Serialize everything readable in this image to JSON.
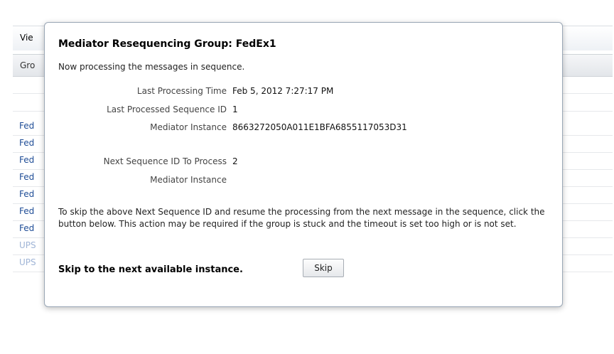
{
  "background": {
    "toolbar_label": "Vie",
    "column_header": "Gro",
    "rows": [
      "",
      "",
      "Fed",
      "Fed",
      "Fed",
      "Fed",
      "Fed",
      "Fed",
      "Fed",
      "UPS",
      "UPS"
    ]
  },
  "dialog": {
    "title": "Mediator Resequencing Group: FedEx1",
    "status": "Now processing the messages in sequence.",
    "fields": [
      {
        "label": "Last Processing Time",
        "value": "Feb 5, 2012 7:27:17 PM"
      },
      {
        "label": "Last Processed Sequence ID",
        "value": "1"
      },
      {
        "label": "Mediator Instance",
        "value": "8663272050A011E1BFA6855117053D31"
      },
      {
        "label": "Next Sequence ID To Process",
        "value": "2"
      },
      {
        "label": "Mediator Instance",
        "value": ""
      }
    ],
    "description": "To skip the above Next Sequence ID and resume the processing from the next message in the sequence, click the button below. This action may be required if the group is stuck and the timeout is set too high or is not set.",
    "skip_text": "Skip to the next available instance.",
    "skip_button": "Skip"
  }
}
